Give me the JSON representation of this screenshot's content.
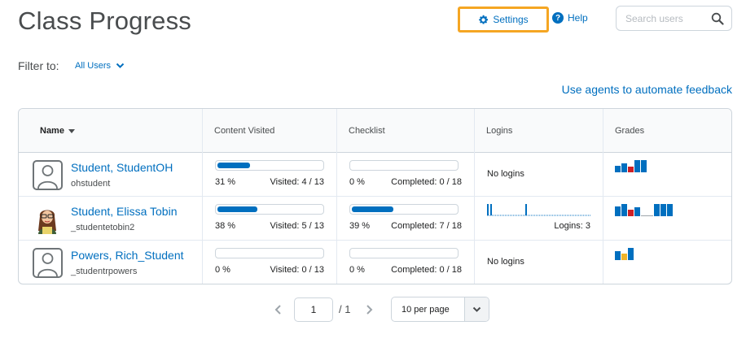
{
  "header": {
    "title": "Class Progress",
    "settings_label": "Settings",
    "help_label": "Help",
    "search_placeholder": "Search users"
  },
  "filter": {
    "label": "Filter to:",
    "value": "All Users"
  },
  "agents_link": "Use agents to automate feedback",
  "columns": [
    "Name",
    "Content Visited",
    "Checklist",
    "Logins",
    "Grades"
  ],
  "students": [
    {
      "name": "Student, StudentOH",
      "username": "ohstudent",
      "avatar": "generic-user-icon",
      "content_pct": "31 %",
      "content_fraction": 0.31,
      "content_visited": "Visited: 4 / 13",
      "checklist_pct": "0 %",
      "checklist_fraction": 0,
      "checklist_completed": "Completed: 0 / 18",
      "logins_text": "No logins",
      "logins_count": "",
      "grade_colors": [
        "#006fbf",
        "#006fbf",
        "#cd2026",
        "#006fbf",
        "#006fbf"
      ],
      "grade_levels": [
        0.55,
        0.75,
        0.45,
        1.0,
        1.0
      ]
    },
    {
      "name": "Student, Elissa Tobin",
      "username": "_studentetobin2",
      "avatar": "photo-avatar",
      "content_pct": "38 %",
      "content_fraction": 0.38,
      "content_visited": "Visited: 5 / 13",
      "checklist_pct": "39 %",
      "checklist_fraction": 0.39,
      "checklist_completed": "Completed: 7 / 18",
      "logins_text": "",
      "logins_count": "Logins: 3",
      "grade_colors": [
        "#006fbf",
        "#006fbf",
        "#cd2026",
        "#006fbf",
        "",
        "#006fbf",
        "#006fbf",
        "#006fbf"
      ],
      "grade_levels": [
        0.8,
        1.0,
        0.5,
        0.75,
        0,
        1.0,
        1.0,
        1.0
      ]
    },
    {
      "name": "Powers, Rich_Student",
      "username": "_studentrpowers",
      "avatar": "generic-user-icon",
      "content_pct": "0 %",
      "content_fraction": 0,
      "content_visited": "Visited: 0 / 13",
      "checklist_pct": "0 %",
      "checklist_fraction": 0,
      "checklist_completed": "Completed: 0 / 18",
      "logins_text": "No logins",
      "logins_count": "",
      "grade_colors": [
        "#006fbf",
        "#f0b429",
        "#006fbf"
      ],
      "grade_levels": [
        0.75,
        0.55,
        1.0
      ]
    }
  ],
  "pagination": {
    "current_page": "1",
    "total": "/ 1",
    "per_page": "10 per page"
  },
  "colors": {
    "accent": "#006fbf",
    "highlight": "#f5a623",
    "error": "#cd2026",
    "warning": "#f0b429"
  }
}
